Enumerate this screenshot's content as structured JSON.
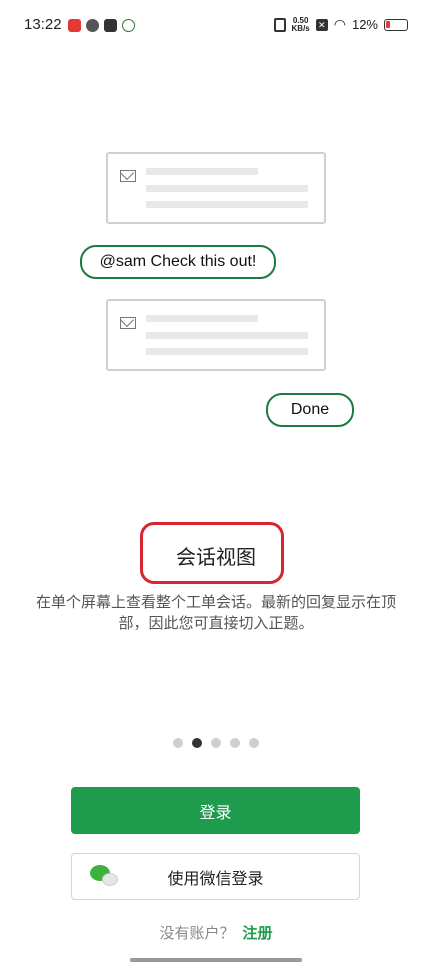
{
  "status_bar": {
    "time": "13:22",
    "net_speed_value": "0.50",
    "net_speed_unit": "KB/s",
    "battery": "12%"
  },
  "illustration": {
    "bubble_mention": "@sam Check this out!",
    "bubble_done": "Done"
  },
  "onboarding": {
    "title": "会话视图",
    "description": "在单个屏幕上查看整个工单会话。最新的回复显示在顶部，因此您可直接切入正题。",
    "page_count": 5,
    "current_page": 2
  },
  "actions": {
    "login_label": "登录",
    "wechat_login_label": "使用微信登录",
    "no_account_text": "没有账户？",
    "signup_label": "注册"
  },
  "colors": {
    "primary_green": "#1e9b4c",
    "highlight_red": "#d7262f"
  }
}
